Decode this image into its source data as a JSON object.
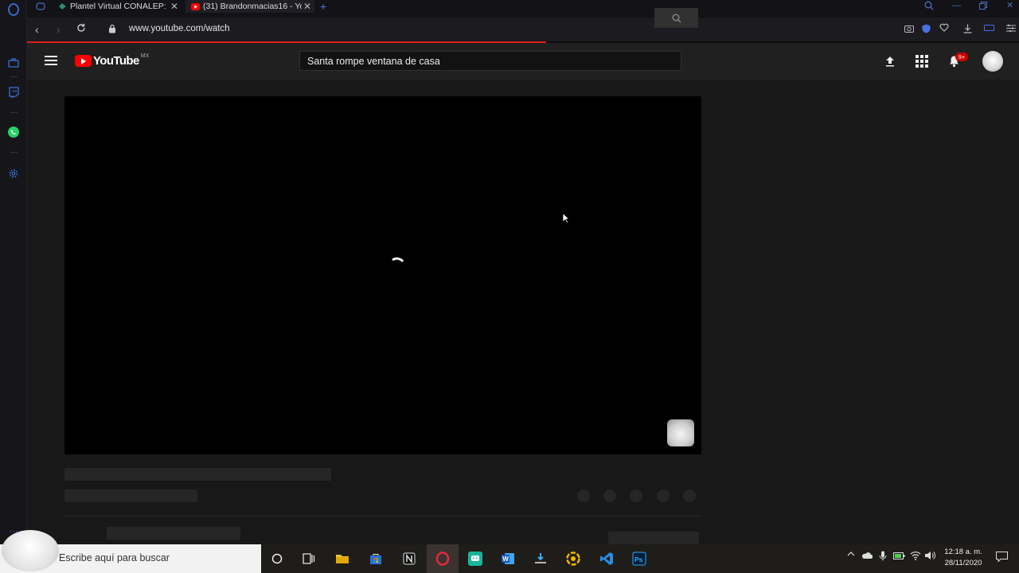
{
  "browser": {
    "tabs": [
      {
        "title": "Plantel Virtual CONALEP: In",
        "favicon": "conalep-favicon"
      },
      {
        "title": "(31) Brandonmacias16 - Yo",
        "favicon": "youtube-favicon"
      }
    ],
    "url": "www.youtube.com/watch"
  },
  "youtube": {
    "logo_text": "YouTube",
    "country_code": "MX",
    "search_query": "Santa rompe ventana de casa",
    "notification_badge": "9+"
  },
  "taskbar": {
    "search_placeholder": "Escribe aquí para buscar",
    "time": "12:18 a. m.",
    "date": "28/11/2020",
    "apps": [
      "cortana",
      "task-view",
      "file-explorer",
      "microsoft-store",
      "notion",
      "opera",
      "ssh-client",
      "word",
      "installer",
      "edge-dev",
      "vscode",
      "photoshop"
    ]
  },
  "colors": {
    "youtube_red": "#ff0000",
    "opera_accent": "#3b6fd8",
    "progress": "#e21b1b"
  }
}
